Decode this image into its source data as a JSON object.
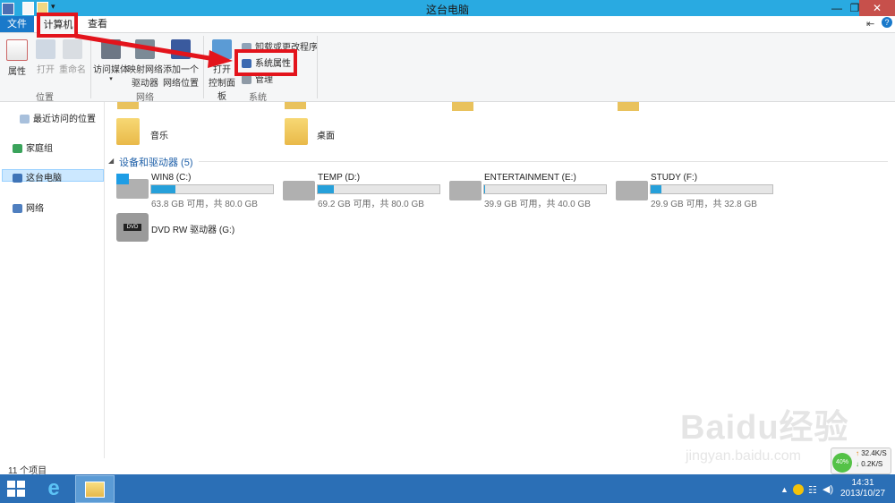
{
  "window": {
    "title": "这台电脑"
  },
  "ribbon_tabs": {
    "file": "文件",
    "computer": "计算机",
    "view": "查看"
  },
  "ribbon": {
    "properties": "属性",
    "open": "打开",
    "rename": "重命名",
    "access_media": "访问媒体",
    "map_drive_1": "映射网络",
    "map_drive_2": "驱动器",
    "add_location_1": "添加一个",
    "add_location_2": "网络位置",
    "open_cp_1": "打开",
    "open_cp_2": "控制面板",
    "uninstall": "卸载或更改程序",
    "system_props": "系统属性",
    "manage": "管理",
    "group_location": "位置",
    "group_network": "网络",
    "group_system": "系统"
  },
  "nav": {
    "recent": "最近访问的位置",
    "homegroup": "家庭组",
    "this_pc": "这台电脑",
    "network": "网络"
  },
  "folders": [
    {
      "name": "音乐"
    },
    {
      "name": "桌面"
    }
  ],
  "drives_section": "设备和驱动器 (5)",
  "drives": [
    {
      "name": "WIN8 (C:)",
      "info": "63.8 GB 可用，共 80.0 GB",
      "used_fraction": 0.2
    },
    {
      "name": "TEMP (D:)",
      "info": "69.2 GB 可用，共 80.0 GB",
      "used_fraction": 0.135
    },
    {
      "name": "ENTERTAINMENT (E:)",
      "info": "39.9 GB 可用，共 40.0 GB",
      "used_fraction": 0.003
    },
    {
      "name": "STUDY (F:)",
      "info": "29.9 GB 可用，共 32.8 GB",
      "used_fraction": 0.09
    },
    {
      "name": "DVD RW 驱动器 (G:)"
    }
  ],
  "status": {
    "item_count": "11 个项目"
  },
  "netwidget": {
    "percent": "40%",
    "up": "32.4K/S",
    "down": "0.2K/S"
  },
  "taskbar": {
    "time": "14:31",
    "date": "2013/10/27"
  },
  "watermark": {
    "logo": "Baidu经验",
    "url": "jingyan.baidu.com"
  },
  "colors": {
    "titlebar": "#29aae1",
    "file_tab": "#1979ca",
    "taskbar": "#2b6fb6",
    "highlight": "#e3141c",
    "bar_fill": "#26a0da",
    "section": "#1e5fa8"
  }
}
